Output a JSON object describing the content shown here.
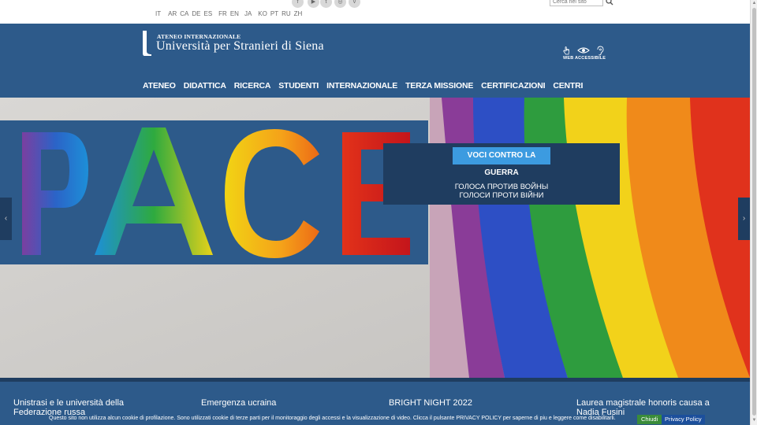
{
  "topbar": {
    "social": [
      {
        "name": "facebook-icon",
        "glyph": "f"
      },
      {
        "name": "youtube-icon",
        "glyph": "▶"
      },
      {
        "name": "twitter-icon",
        "glyph": "t"
      },
      {
        "name": "instagram-icon",
        "glyph": "◎"
      },
      {
        "name": "vimeo-icon",
        "glyph": "v"
      }
    ],
    "languages": [
      "IT",
      "AR",
      "CA",
      "DE",
      "ES",
      "FR",
      "EN",
      "JA",
      "KO",
      "PT",
      "RU",
      "ZH"
    ],
    "search": {
      "placeholder": "Cerca nel sito",
      "icon": "search-icon"
    }
  },
  "header": {
    "logo_top": "ATENEO INTERNAZIONALE",
    "logo_main": "Università per Stranieri di Siena",
    "accessibility_label": "WEB ACCESSIBILE",
    "accessibility_icons": [
      "hand-pointer-icon",
      "eye-icon",
      "ear-icon"
    ]
  },
  "nav": {
    "items": [
      "ATENEO",
      "DIDATTICA",
      "RICERCA",
      "STUDENTI",
      "INTERNAZIONALE",
      "TERZA MISSIONE",
      "CERTIFICAZIONI",
      "CENTRI"
    ]
  },
  "hero": {
    "image_text": "PACE",
    "caption_button": "VOCI CONTRO LA GUERRA",
    "caption_line1": "ГОЛОСА ПРОТИВ ВОЙНЫ",
    "caption_line2": "ГОЛОСИ ПРОТИ ВІЙНИ",
    "prev_icon": "chevron-left-icon",
    "next_icon": "chevron-right-icon"
  },
  "news": {
    "items": [
      "Unistrasi e le università della Federazione russa",
      "Emergenza ucraina",
      "BRIGHT NIGHT 2022",
      "Laurea magistrale honoris causa a Nadia Fusini"
    ]
  },
  "cookie": {
    "text": "Questo sito non utilizza alcun cookie di profilazione. Sono utilizzati cookie di terze parti per il monitoraggio degli accessi e la visualizzazione di video. Clicca il pulsante PRIVACY POLICY per saperne di piu e leggere come disabilitarli.",
    "close_label": "Chiudi",
    "privacy_label": "Privacy Policy"
  },
  "colors": {
    "header_blue": "#2d5a8a",
    "caption_navy": "#1f3d60",
    "button_blue": "#3c9be0",
    "close_green": "#3a8c3a",
    "privacy_blue": "#1c4f9c"
  }
}
